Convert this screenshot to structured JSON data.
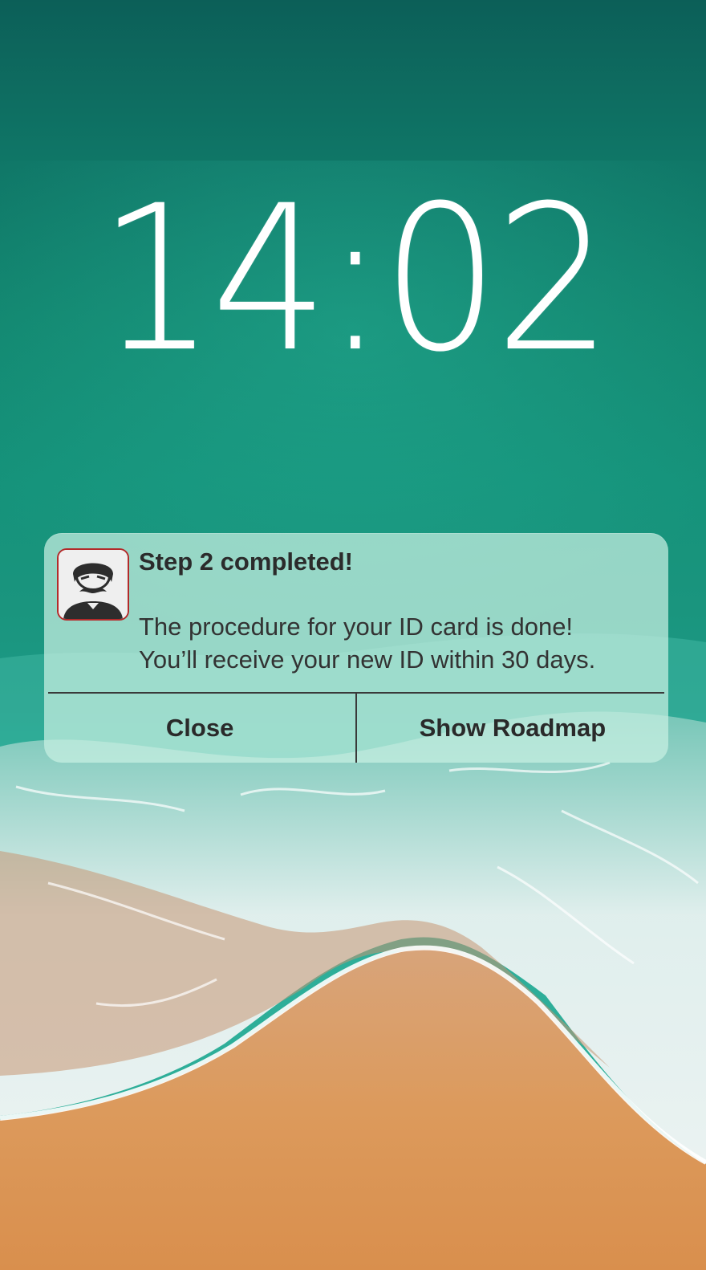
{
  "lockscreen": {
    "time": "14:02"
  },
  "notification": {
    "app_icon": "mustached-man-avatar-icon",
    "title": "Step 2 completed!",
    "body_lines": [
      "The procedure for your ID card is done!",
      "You’ll receive your new ID within 30 days."
    ],
    "actions": {
      "close_label": "Close",
      "show_roadmap_label": "Show Roadmap"
    }
  },
  "colors": {
    "sea_deep": "#0c5f58",
    "sea_shallow": "#1aa58f",
    "foam": "#e8f1f0",
    "sand": "#d99659",
    "icon_border": "#b32a2a",
    "notification_bg": "#c8f0e2"
  }
}
